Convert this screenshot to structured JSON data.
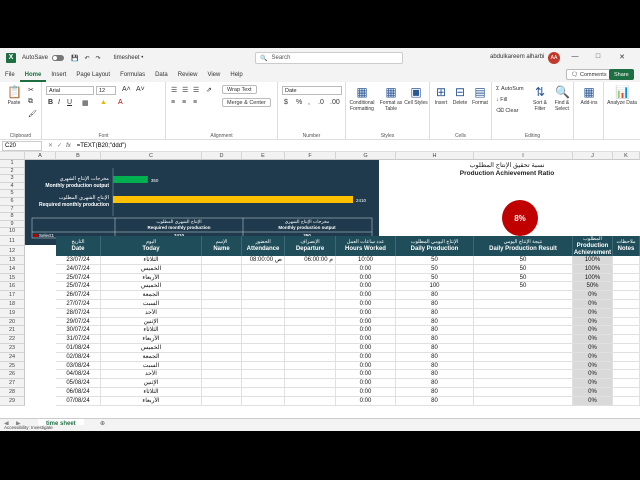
{
  "titlebar": {
    "autosave": "AutoSave",
    "filename": "timesheet  •",
    "search_placeholder": "Search",
    "user": "abdulkareem alharbi",
    "user_initials": "AA"
  },
  "menu": {
    "tabs": [
      "File",
      "Home",
      "Insert",
      "Page Layout",
      "Formulas",
      "Data",
      "Review",
      "View",
      "Help"
    ],
    "active": "Home",
    "comments": "Comments",
    "share": "Share"
  },
  "ribbon": {
    "paste": "Paste",
    "clipboard": "Clipboard",
    "font_name": "Arial",
    "font_size": "12",
    "font": "Font",
    "wrap_text": "Wrap Text",
    "merge_center": "Merge & Center",
    "alignment": "Alignment",
    "number_format": "Date",
    "number": "Number",
    "conditional_formatting": "Conditional Formatting",
    "format_as_table": "Format as Table",
    "cell_styles": "Cell Styles",
    "styles": "Styles",
    "insert": "Insert",
    "delete": "Delete",
    "format": "Format",
    "cells": "Cells",
    "autosum": "AutoSum",
    "fill": "Fill",
    "clear": "Clear",
    "sort_filter": "Sort & Filter",
    "find_select": "Find & Select",
    "editing": "Editing",
    "addins": "Add-ins",
    "analyze_data": "Analyze Data"
  },
  "formulabar": {
    "namebox": "C20",
    "formula": "=TEXT(B20;\"ddd\")"
  },
  "columns": [
    "A",
    "B",
    "C",
    "D",
    "E",
    "F",
    "G",
    "H",
    "I",
    "J",
    "K"
  ],
  "rows": [
    "1",
    "2",
    "3",
    "4",
    "5",
    "6",
    "7",
    "8",
    "9",
    "10",
    "11",
    "12",
    "13",
    "14",
    "15",
    "16",
    "17",
    "18",
    "19",
    "20",
    "21",
    "22",
    "23",
    "24",
    "25",
    "26",
    "27",
    "28",
    "29"
  ],
  "chart": {
    "bar1_label_ar": "مخرجات الإنتاج الشهري",
    "bar1_label_en": "Monthly production output",
    "bar1_value": 350,
    "bar1_value_text": "350",
    "bar1_color": "#00b050",
    "bar2_label_ar": "الإنتاج الشهري المطلوب",
    "bar2_label_en": "Required monthly production",
    "bar2_value": 2410,
    "bar2_value_text": "2410",
    "bar2_color": "#ffc000",
    "table_h1_ar": "الإنتاج الشهري المطلوب",
    "table_h1_en": "Required monthly production",
    "table_h2_ar": "مخرجات الإنتاج الشهري",
    "table_h2_en": "Monthly production output",
    "table_v1": "2410",
    "table_v2": "350",
    "select_label": "Select1"
  },
  "pie": {
    "title_ar": "نسبة تحقيق الإنتاج المطلوب",
    "title_en": "Production Achievement Ratio",
    "value_text": "8%",
    "color": "#c00000"
  },
  "headers": [
    {
      "ar": "التاريخ",
      "en": "Date"
    },
    {
      "ar": "اليوم",
      "en": "Today"
    },
    {
      "ar": "الإسم",
      "en": "Name"
    },
    {
      "ar": "الحضور",
      "en": "Attendance"
    },
    {
      "ar": "الإنصراف",
      "en": "Departure"
    },
    {
      "ar": "عدد ساعات العمل",
      "en": "Hours Worked"
    },
    {
      "ar": "الإنتاج اليومي المطلوب",
      "en": "Daily Production"
    },
    {
      "ar": "نتيجة الإنتاج اليومي",
      "en": "Daily Production Result"
    },
    {
      "ar": "نسبة تحقيق الإنتاج المطلوب",
      "en": "Production Achievement Ratio"
    },
    {
      "ar": "ملاحظات",
      "en": "Notes"
    }
  ],
  "table_rows": [
    {
      "date": "23/07/24",
      "day": "الثلاثاء",
      "att": "08:00:00 ص",
      "dep": "06:00:00 م",
      "hours": "10:00",
      "daily": "50",
      "result": "50",
      "ratio": "100%"
    },
    {
      "date": "24/07/24",
      "day": "الخميس",
      "att": "",
      "dep": "",
      "hours": "0:00",
      "daily": "50",
      "result": "50",
      "ratio": "100%"
    },
    {
      "date": "25/07/24",
      "day": "الأربعاء",
      "att": "",
      "dep": "",
      "hours": "0:00",
      "daily": "50",
      "result": "50",
      "ratio": "100%"
    },
    {
      "date": "25/07/24",
      "day": "الخميس",
      "att": "",
      "dep": "",
      "hours": "0:00",
      "daily": "100",
      "result": "50",
      "ratio": "50%"
    },
    {
      "date": "26/07/24",
      "day": "الجمعة",
      "att": "",
      "dep": "",
      "hours": "0:00",
      "daily": "80",
      "result": "",
      "ratio": "0%"
    },
    {
      "date": "27/07/24",
      "day": "السبت",
      "att": "",
      "dep": "",
      "hours": "0:00",
      "daily": "80",
      "result": "",
      "ratio": "0%"
    },
    {
      "date": "28/07/24",
      "day": "الأحد",
      "att": "",
      "dep": "",
      "hours": "0:00",
      "daily": "80",
      "result": "",
      "ratio": "0%"
    },
    {
      "date": "29/07/24",
      "day": "الإثنين",
      "att": "",
      "dep": "",
      "hours": "0:00",
      "daily": "80",
      "result": "",
      "ratio": "0%"
    },
    {
      "date": "30/07/24",
      "day": "الثلاثاء",
      "att": "",
      "dep": "",
      "hours": "0:00",
      "daily": "80",
      "result": "",
      "ratio": "0%"
    },
    {
      "date": "31/07/24",
      "day": "الأربعاء",
      "att": "",
      "dep": "",
      "hours": "0:00",
      "daily": "80",
      "result": "",
      "ratio": "0%"
    },
    {
      "date": "01/08/24",
      "day": "الخميس",
      "att": "",
      "dep": "",
      "hours": "0:00",
      "daily": "80",
      "result": "",
      "ratio": "0%"
    },
    {
      "date": "02/08/24",
      "day": "الجمعة",
      "att": "",
      "dep": "",
      "hours": "0:00",
      "daily": "80",
      "result": "",
      "ratio": "0%"
    },
    {
      "date": "03/08/24",
      "day": "السبت",
      "att": "",
      "dep": "",
      "hours": "0:00",
      "daily": "80",
      "result": "",
      "ratio": "0%"
    },
    {
      "date": "04/08/24",
      "day": "الأحد",
      "att": "",
      "dep": "",
      "hours": "0:00",
      "daily": "80",
      "result": "",
      "ratio": "0%"
    },
    {
      "date": "05/08/24",
      "day": "الإثنين",
      "att": "",
      "dep": "",
      "hours": "0:00",
      "daily": "80",
      "result": "",
      "ratio": "0%"
    },
    {
      "date": "06/08/24",
      "day": "الثلاثاء",
      "att": "",
      "dep": "",
      "hours": "0:00",
      "daily": "80",
      "result": "",
      "ratio": "0%"
    },
    {
      "date": "07/08/24",
      "day": "الأربعاء",
      "att": "",
      "dep": "",
      "hours": "0:00",
      "daily": "80",
      "result": "",
      "ratio": "0%"
    }
  ],
  "sheet": {
    "tab": "time sheet",
    "status": "Accessibility: Investigate"
  }
}
